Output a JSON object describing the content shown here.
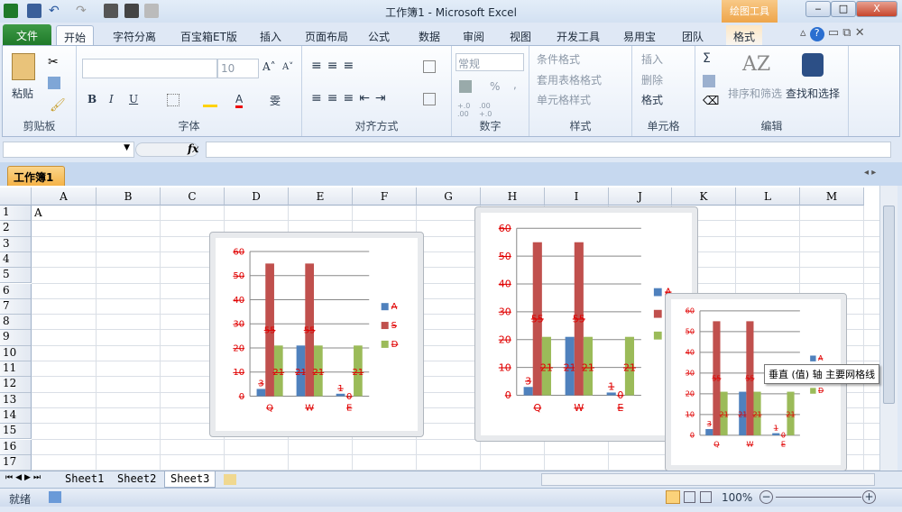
{
  "window": {
    "title": "工作簿1 - Microsoft Excel",
    "context_tab": "绘图工具",
    "minimize": "‒",
    "maximize": "□",
    "close": "X"
  },
  "tabs": [
    "文件",
    "开始",
    "字符分离",
    "百宝箱ET版",
    "插入",
    "页面布局",
    "公式",
    "数据",
    "审阅",
    "视图",
    "开发工具",
    "易用宝",
    "团队",
    "格式"
  ],
  "ribbon": {
    "clipboard": {
      "paste": "粘贴",
      "label": "剪贴板"
    },
    "font": {
      "size": "10",
      "bold": "B",
      "italic": "I",
      "underline": "U",
      "grow": "A˄",
      "shrink": "A˅",
      "color": "A",
      "phonetic": "雯",
      "label": "字体"
    },
    "align": {
      "label": "对齐方式"
    },
    "number": {
      "format": "常规",
      "percent": "%",
      "comma": ",",
      "inc": "+.0 .00",
      "dec": ".00 +.0",
      "label": "数字"
    },
    "styles": {
      "cond": "条件格式",
      "table": "套用表格格式",
      "cell": "单元格样式",
      "label": "样式"
    },
    "cells": {
      "insert": "插入",
      "delete": "删除",
      "format": "格式",
      "label": "单元格"
    },
    "editing": {
      "sum": "Σ",
      "sort": "排序和筛选",
      "find": "查找和选择",
      "label": "编辑"
    }
  },
  "formula": {
    "fx": "fx",
    "value": ""
  },
  "workbook_tab": "工作簿1",
  "columns": [
    "A",
    "B",
    "C",
    "D",
    "E",
    "F",
    "G",
    "H",
    "I",
    "J",
    "K",
    "L",
    "M"
  ],
  "rows": [
    "1",
    "2",
    "3",
    "4",
    "5",
    "6",
    "7",
    "8",
    "9",
    "10",
    "11",
    "12",
    "13",
    "14",
    "15",
    "16",
    "17"
  ],
  "cell_A1": "A",
  "colors": {
    "A": "#4f81bd",
    "S": "#c0504d",
    "D": "#9bbb59",
    "label": "#e00000"
  },
  "chart_data": {
    "type": "bar",
    "categories": [
      "Q",
      "W",
      "E"
    ],
    "series": [
      {
        "name": "A",
        "values": [
          3,
          21,
          1
        ]
      },
      {
        "name": "S",
        "values": [
          55,
          55,
          0
        ]
      },
      {
        "name": "D",
        "values": [
          21,
          21,
          21
        ]
      }
    ],
    "ylim": [
      0,
      60
    ],
    "yticks": [
      "0",
      "10",
      "20",
      "30",
      "40",
      "50",
      "60"
    ],
    "legend": "right"
  },
  "tooltip": "垂直 (值) 轴 主要网格线",
  "sheets": [
    "Sheet1",
    "Sheet2",
    "Sheet3"
  ],
  "status": {
    "ready": "就绪",
    "zoom": "100%",
    "minus": "−",
    "plus": "+"
  }
}
